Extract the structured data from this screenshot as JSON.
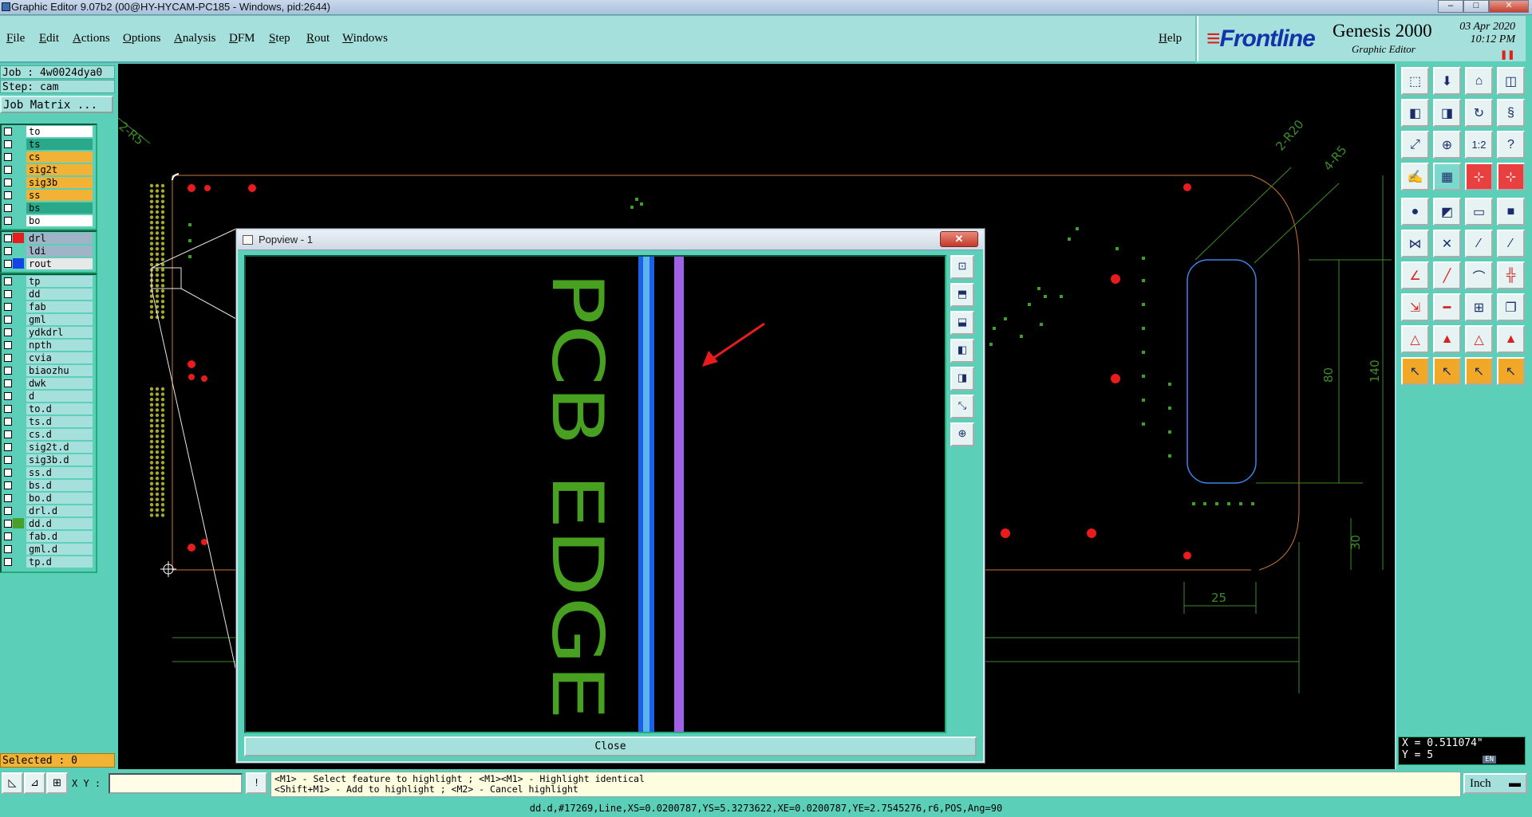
{
  "window": {
    "title": "Graphic Editor 9.07b2 (00@HY-HYCAM-PC185 - Windows, pid:2644)",
    "controls": [
      "–",
      "□",
      "✕"
    ]
  },
  "menubar": {
    "items": [
      "File",
      "Edit",
      "Actions",
      "Options",
      "Analysis",
      "DFM",
      "Step",
      "Rout",
      "Windows"
    ],
    "help": "Help"
  },
  "brand": {
    "logo": "Frontline",
    "product": "Genesis 2000",
    "subtitle": "Graphic Editor",
    "date": "03 Apr 2020",
    "time": "10:12 PM",
    "accent": "#1433a8",
    "logo_red": "#e0201c"
  },
  "left_panel": {
    "job": "Job : 4w0024dya0",
    "step": "Step: cam",
    "job_matrix": "Job Matrix ...",
    "board_layers": [
      {
        "name": "to",
        "color": "#ffffff"
      },
      {
        "name": "ts",
        "color": "#2aa88a"
      },
      {
        "name": "cs",
        "color": "#f2b236"
      },
      {
        "name": "sig2t",
        "color": "#f2b236"
      },
      {
        "name": "sig3b",
        "color": "#f2b236"
      },
      {
        "name": "ss",
        "color": "#f2b236"
      },
      {
        "name": "bs",
        "color": "#2aa88a"
      },
      {
        "name": "bo",
        "color": "#ffffff"
      }
    ],
    "drill_layers": [
      {
        "name": "drl",
        "color": "#a0b4c8",
        "swatch": "#e81c1c"
      },
      {
        "name": "ldi",
        "color": "#a0b4c8",
        "swatch": ""
      },
      {
        "name": "rout",
        "color": "#e8e8e8",
        "swatch": "#1444e8"
      }
    ],
    "misc_layers": [
      {
        "name": "tp",
        "color": "#a6e0dc",
        "swatch": ""
      },
      {
        "name": "dd",
        "color": "#a6e0dc",
        "swatch": ""
      },
      {
        "name": "fab",
        "color": "#a6e0dc",
        "swatch": ""
      },
      {
        "name": "gml",
        "color": "#a6e0dc",
        "swatch": ""
      },
      {
        "name": "ydkdrl",
        "color": "#a6e0dc",
        "swatch": ""
      },
      {
        "name": "npth",
        "color": "#a6e0dc",
        "swatch": ""
      },
      {
        "name": "cvia",
        "color": "#a6e0dc",
        "swatch": ""
      },
      {
        "name": "biaozhu",
        "color": "#a6e0dc",
        "swatch": ""
      },
      {
        "name": "dwk",
        "color": "#a6e0dc",
        "swatch": ""
      },
      {
        "name": "d",
        "color": "#a6e0dc",
        "swatch": ""
      },
      {
        "name": "to.d",
        "color": "#a6e0dc",
        "swatch": ""
      },
      {
        "name": "ts.d",
        "color": "#a6e0dc",
        "swatch": ""
      },
      {
        "name": "cs.d",
        "color": "#a6e0dc",
        "swatch": ""
      },
      {
        "name": "sig2t.d",
        "color": "#a6e0dc",
        "swatch": ""
      },
      {
        "name": "sig3b.d",
        "color": "#a6e0dc",
        "swatch": ""
      },
      {
        "name": "ss.d",
        "color": "#a6e0dc",
        "swatch": ""
      },
      {
        "name": "bs.d",
        "color": "#a6e0dc",
        "swatch": ""
      },
      {
        "name": "bo.d",
        "color": "#a6e0dc",
        "swatch": ""
      },
      {
        "name": "drl.d",
        "color": "#a6e0dc",
        "swatch": ""
      },
      {
        "name": "dd.d",
        "color": "#a6e0dc",
        "swatch": "#48a02a"
      },
      {
        "name": "fab.d",
        "color": "#a6e0dc",
        "swatch": ""
      },
      {
        "name": "gml.d",
        "color": "#a6e0dc",
        "swatch": ""
      },
      {
        "name": "tp.d",
        "color": "#a6e0dc",
        "swatch": ""
      }
    ],
    "selected": "Selected : 0"
  },
  "canvas": {
    "dimension_labels": [
      "2-R5",
      "2-R20",
      "4-R5",
      "80",
      "140",
      "30",
      "25"
    ],
    "outline_color": "#c87832",
    "dim_color": "#3c8c28",
    "pad_color": "#e81c1c"
  },
  "popview": {
    "title": "Popview - 1",
    "close_x": "✕",
    "board_text": "PCB EDGE",
    "text_color": "#48a020",
    "close_button": "Close"
  },
  "coords": {
    "x": "X = 0.511074\"",
    "y": "Y = 5",
    "ime": "EN"
  },
  "bottom": {
    "xy_label": "X Y :",
    "xy_value": "",
    "hint_line1": "<M1> - Select feature to highlight ; <M1><M1> - Highlight identical",
    "hint_line2": "<Shift+M1> - Add to highlight ; <M2> - Cancel highlight",
    "units": "Inch"
  },
  "status": "dd.d,#17269,Line,XS=0.0200787,YS=5.3273622,XE=0.0200787,YE=2.7545276,r6,POS,Ang=90"
}
